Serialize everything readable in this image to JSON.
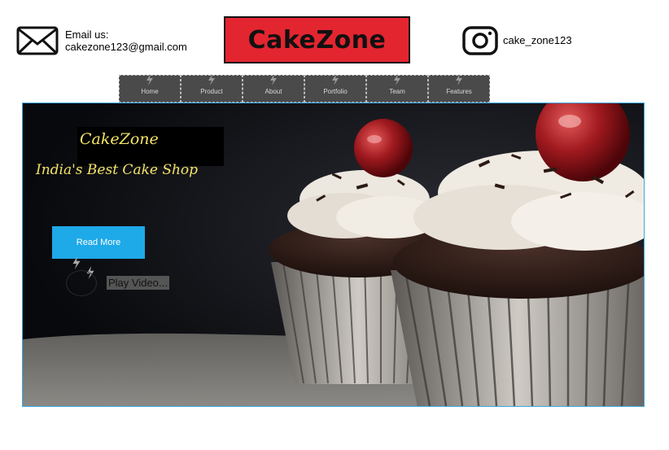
{
  "header": {
    "email_label": "Email us:",
    "email_value": "cakezone123@gmail.com",
    "logo_text": "CakeZone",
    "instagram_handle": "cake_zone123"
  },
  "nav": {
    "items": [
      {
        "label": "Home"
      },
      {
        "label": "Product"
      },
      {
        "label": "About"
      },
      {
        "label": "Portfolio"
      },
      {
        "label": "Team"
      },
      {
        "label": "Features"
      }
    ]
  },
  "hero": {
    "brand": "CakeZone",
    "tagline": "India's Best Cake Shop",
    "read_more_label": "Read More",
    "play_video_label": "Play Video..."
  },
  "colors": {
    "logo_bg": "#e32530",
    "accent_button": "#1ea9e8",
    "hero_text": "#f3e36a",
    "nav_bg": "#4a4a4a"
  }
}
